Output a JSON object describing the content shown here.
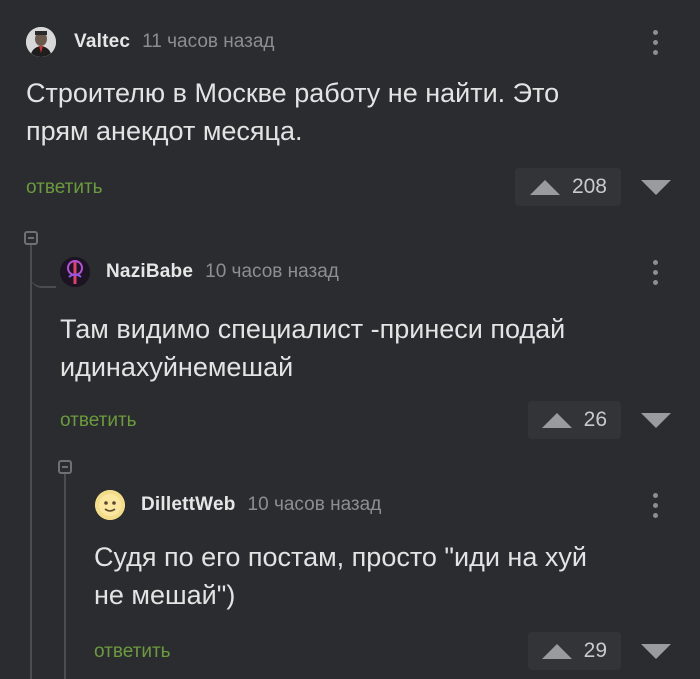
{
  "comments": [
    {
      "username": "Valtec",
      "time": "11 часов назад",
      "text": "Строителю в Москве работу не найти. Это\nпрям анекдот месяца.",
      "reply_label": "ответить",
      "rating": "208",
      "avatar_icon": "user-portrait-icon"
    },
    {
      "username": "NaziBabe",
      "time": "10 часов назад",
      "text": "Там видимо специалист -принеси подай\nидинахуйнемешай",
      "reply_label": "ответить",
      "rating": "26",
      "avatar_icon": "neon-figure-icon"
    },
    {
      "username": "DillettWeb",
      "time": "10 часов назад",
      "text": "Судя по его постам, просто \"иди на хуй\nне мешай\")",
      "reply_label": "ответить",
      "rating": "29",
      "avatar_icon": "yellow-face-icon"
    }
  ],
  "colors": {
    "background": "#2b2c2f",
    "reply_link": "#6c9a3e",
    "username": "#e6e6e6",
    "meta": "#8d8e91"
  }
}
